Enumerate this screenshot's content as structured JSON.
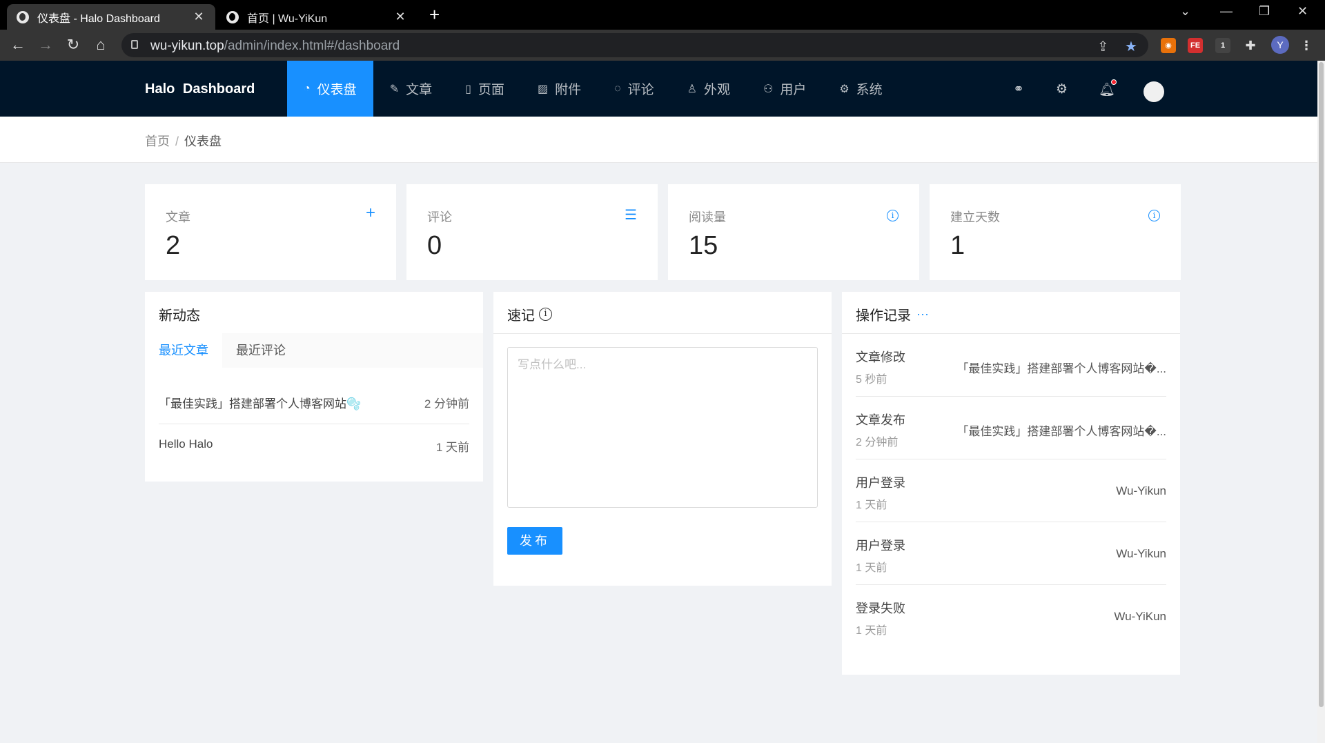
{
  "browser": {
    "tabs": [
      {
        "title": "仪表盘 - Halo Dashboard",
        "active": true
      },
      {
        "title": "首页 | Wu-YiKun",
        "active": false
      }
    ],
    "url_host": "wu-yikun.top",
    "url_path": "/admin/index.html#/dashboard",
    "profile_initial": "Y",
    "ext_badge": "1"
  },
  "app": {
    "brand": "Halo Dashboard",
    "menu": [
      {
        "label": "仪表盘",
        "icon": "dashboard-icon",
        "glyph": "◔"
      },
      {
        "label": "文章",
        "icon": "form-icon",
        "glyph": "✎"
      },
      {
        "label": "页面",
        "icon": "read-icon",
        "glyph": "▯"
      },
      {
        "label": "附件",
        "icon": "picture-icon",
        "glyph": "▨"
      },
      {
        "label": "评论",
        "icon": "message-icon",
        "glyph": "◌"
      },
      {
        "label": "外观",
        "icon": "skin-icon",
        "glyph": "♙"
      },
      {
        "label": "用户",
        "icon": "user-icon",
        "glyph": "⚇"
      },
      {
        "label": "系统",
        "icon": "setting-icon",
        "glyph": "⚙"
      }
    ]
  },
  "breadcrumb": {
    "home": "首页",
    "separator": "/",
    "current": "仪表盘"
  },
  "stats": [
    {
      "label": "文章",
      "value": "2",
      "icon": "plus-icon"
    },
    {
      "label": "评论",
      "value": "0",
      "icon": "list-icon"
    },
    {
      "label": "阅读量",
      "value": "15",
      "icon": "info-icon"
    },
    {
      "label": "建立天数",
      "value": "1",
      "icon": "info-icon"
    }
  ],
  "activity": {
    "title": "新动态",
    "tabs": [
      "最近文章",
      "最近评论"
    ],
    "items": [
      {
        "title": "「最佳实践」搭建部署个人博客网站🫧",
        "time": "2 分钟前"
      },
      {
        "title": "Hello Halo",
        "time": "1 天前"
      }
    ]
  },
  "memo": {
    "title": "速记",
    "placeholder": "写点什么吧...",
    "publish_label": "发布"
  },
  "logs": {
    "title": "操作记录",
    "more": "···",
    "items": [
      {
        "action": "文章修改",
        "time": "5 秒前",
        "target": "「最佳实践」搭建部署个人博客网站�..."
      },
      {
        "action": "文章发布",
        "time": "2 分钟前",
        "target": "「最佳实践」搭建部署个人博客网站�..."
      },
      {
        "action": "用户登录",
        "time": "1 天前",
        "target": "Wu-Yikun"
      },
      {
        "action": "用户登录",
        "time": "1 天前",
        "target": "Wu-Yikun"
      },
      {
        "action": "登录失败",
        "time": "1 天前",
        "target": "Wu-YiKun"
      }
    ]
  },
  "colors": {
    "header_bg": "#001529",
    "accent": "#1890ff",
    "page_bg": "#f0f2f5"
  }
}
